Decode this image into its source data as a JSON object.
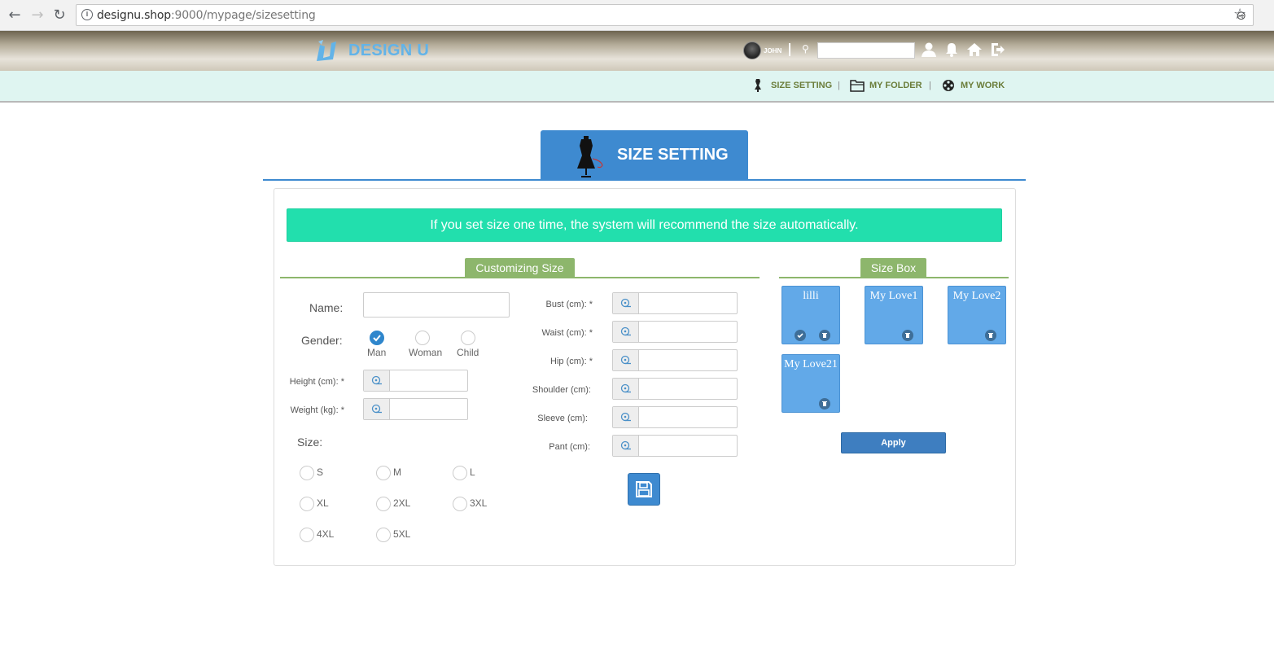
{
  "browser": {
    "url_host": "designu.shop",
    "url_rest": ":9000/mypage/sizesetting"
  },
  "header": {
    "logo_text": "DESIGN U",
    "username": "JOHN",
    "search_value": ""
  },
  "subnav": {
    "items": [
      {
        "label": "SIZE SETTING"
      },
      {
        "label": "MY FOLDER"
      },
      {
        "label": "MY WORK"
      }
    ],
    "separator": "|"
  },
  "page": {
    "title": "SIZE SETTING",
    "notice": "If you set size one time, the system will recommend the size automatically."
  },
  "customizing": {
    "section_label": "Customizing Size",
    "name_label": "Name:",
    "name_value": "",
    "gender_label": "Gender:",
    "genders": [
      {
        "label": "Man",
        "checked": true
      },
      {
        "label": "Woman",
        "checked": false
      },
      {
        "label": "Child",
        "checked": false
      }
    ],
    "height_label": "Height (cm): *",
    "weight_label": "Weight (kg): *",
    "size_label": "Size:",
    "sizes": [
      "S",
      "M",
      "L",
      "XL",
      "2XL",
      "3XL",
      "4XL",
      "5XL"
    ],
    "measurements": [
      {
        "label": "Bust (cm): *",
        "value": ""
      },
      {
        "label": "Waist (cm): *",
        "value": ""
      },
      {
        "label": "Hip (cm): *",
        "value": ""
      },
      {
        "label": "Shoulder (cm):",
        "value": ""
      },
      {
        "label": "Sleeve (cm):",
        "value": ""
      },
      {
        "label": "Pant (cm):",
        "value": ""
      }
    ]
  },
  "sizebox": {
    "section_label": "Size Box",
    "boxes": [
      {
        "name": "lilli",
        "selected": true
      },
      {
        "name": "My Love1",
        "selected": false
      },
      {
        "name": "My Love2",
        "selected": false
      },
      {
        "name": "My Love21",
        "selected": false
      }
    ],
    "apply_label": "Apply"
  },
  "colors": {
    "primary": "#3e8ad0",
    "notice_bg": "#22dfad",
    "section_green": "#8db66c",
    "sizebox_bg": "#62a9e8",
    "logo": "#62b3e8"
  }
}
